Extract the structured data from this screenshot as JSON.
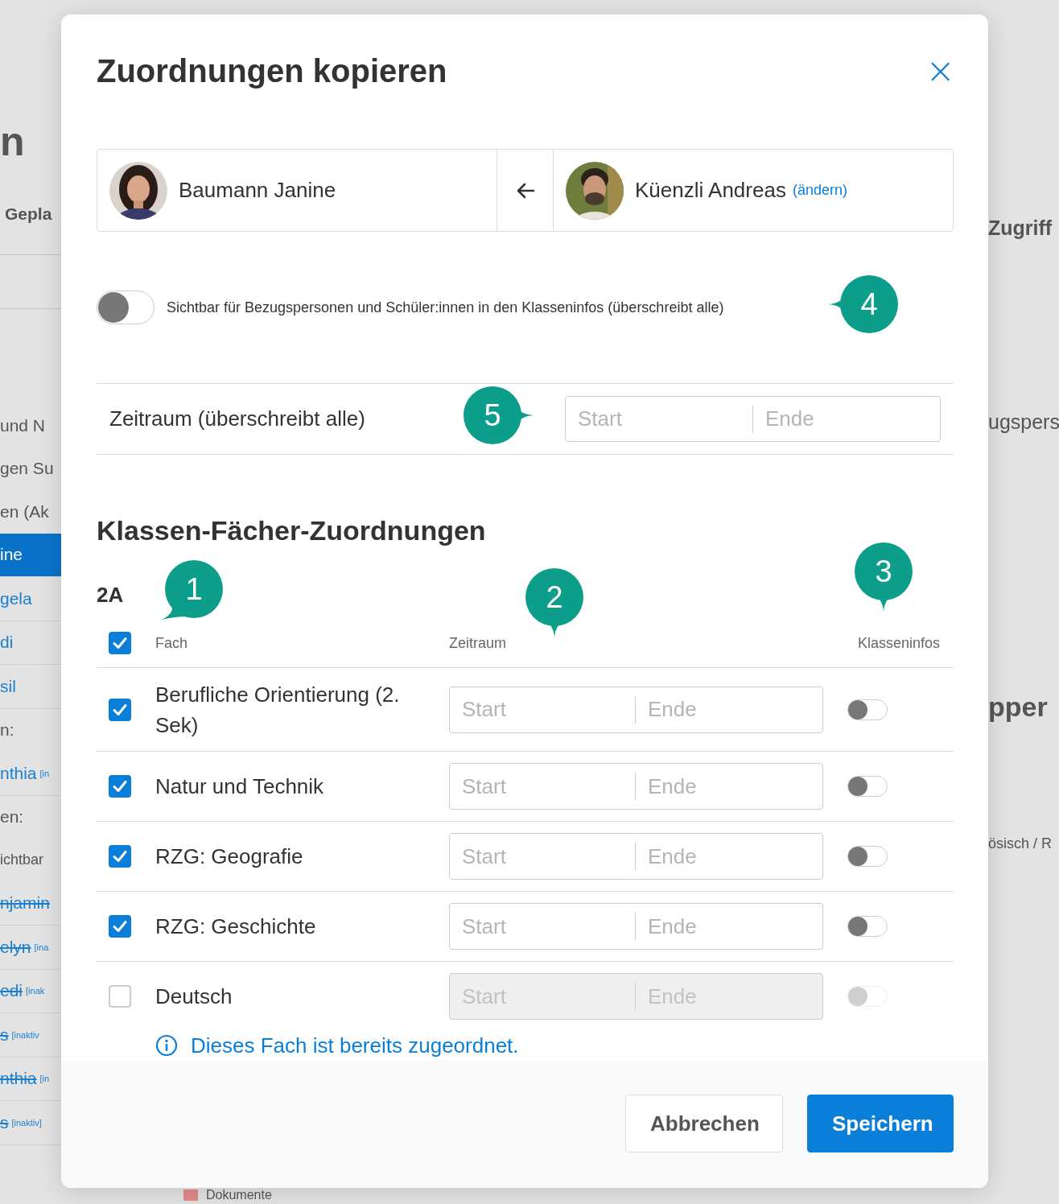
{
  "background": {
    "left_top": [
      {
        "text": "n",
        "kind": "heading"
      },
      {
        "text": "Gepla",
        "kind": "column"
      }
    ],
    "left_list": [
      {
        "text": "und N",
        "kind": "text"
      },
      {
        "text": "gen Su",
        "kind": "text"
      },
      {
        "text": "en (Ak",
        "kind": "text"
      },
      {
        "text": "ine",
        "kind": "selected"
      },
      {
        "text": "gela",
        "kind": "link"
      },
      {
        "text": "di",
        "kind": "link"
      },
      {
        "text": "sil",
        "kind": "link"
      },
      {
        "text": "n:",
        "kind": "label"
      },
      {
        "text": "nthia",
        "note": "[in",
        "kind": "link"
      },
      {
        "text": "en:",
        "kind": "label"
      },
      {
        "text": "ichtbar",
        "kind": "small"
      },
      {
        "text": "njamin",
        "kind": "inactive"
      },
      {
        "text": "elyn",
        "note": "[ina",
        "kind": "inactive"
      },
      {
        "text": "edi",
        "note": "[inak",
        "kind": "inactive"
      },
      {
        "text": "s",
        "note": "[inaktiv",
        "kind": "inactive"
      },
      {
        "text": "nthia",
        "note": "[in",
        "kind": "inactive"
      },
      {
        "text": "s",
        "note": "[inaktiv]",
        "kind": "inactive"
      }
    ],
    "right": [
      {
        "text": "Zugriff",
        "kind": "column"
      },
      {
        "text": "ugspers",
        "kind": "text"
      },
      {
        "text": "pper",
        "kind": "heading"
      },
      {
        "text": "ösisch / R",
        "kind": "small"
      }
    ],
    "bottom": {
      "text": "Dokumente"
    }
  },
  "dialog": {
    "title": "Zuordnungen kopieren",
    "close": "×",
    "target": {
      "name": "Baumann Janine"
    },
    "source": {
      "name": "Küenzli Andreas",
      "change_link": "(ändern)"
    },
    "visibility": {
      "label": "Sichtbar für Bezugspersonen und Schüler:innen in den Klasseninfos (überschreibt alle)",
      "on": false,
      "marker": {
        "label": "4"
      }
    },
    "period": {
      "label": "Zeitraum (überschreibt alle)",
      "start_placeholder": "Start",
      "end_placeholder": "Ende",
      "marker": {
        "label": "5"
      }
    },
    "section_title": "Klassen-Fächer-Zuordnungen",
    "class_name": "2A",
    "class_marker": {
      "label": "1"
    },
    "all_checked": true,
    "columns": [
      {
        "label": "Fach"
      },
      {
        "label": "Zeitraum",
        "marker": {
          "label": "2"
        }
      },
      {
        "label": "Klasseninfos",
        "marker": {
          "label": "3"
        }
      }
    ],
    "rows": [
      {
        "subject": "Berufliche Orientierung (2. Sek)",
        "checked": true,
        "disabled": false,
        "start_placeholder": "Start",
        "end_placeholder": "Ende",
        "on": false
      },
      {
        "subject": "Natur und Technik",
        "checked": true,
        "disabled": false,
        "start_placeholder": "Start",
        "end_placeholder": "Ende",
        "on": false
      },
      {
        "subject": "RZG: Geografie",
        "checked": true,
        "disabled": false,
        "start_placeholder": "Start",
        "end_placeholder": "Ende",
        "on": false
      },
      {
        "subject": "RZG: Geschichte",
        "checked": true,
        "disabled": false,
        "start_placeholder": "Start",
        "end_placeholder": "Ende",
        "on": false
      },
      {
        "subject": "Deutsch",
        "checked": false,
        "disabled": true,
        "start_placeholder": "Start",
        "end_placeholder": "Ende",
        "on": false
      }
    ],
    "info": "Dieses Fach ist bereits zugeordnet.",
    "buttons": [
      {
        "label": "Abbrechen",
        "kind": "secondary"
      },
      {
        "label": "Speichern",
        "kind": "primary"
      }
    ]
  }
}
